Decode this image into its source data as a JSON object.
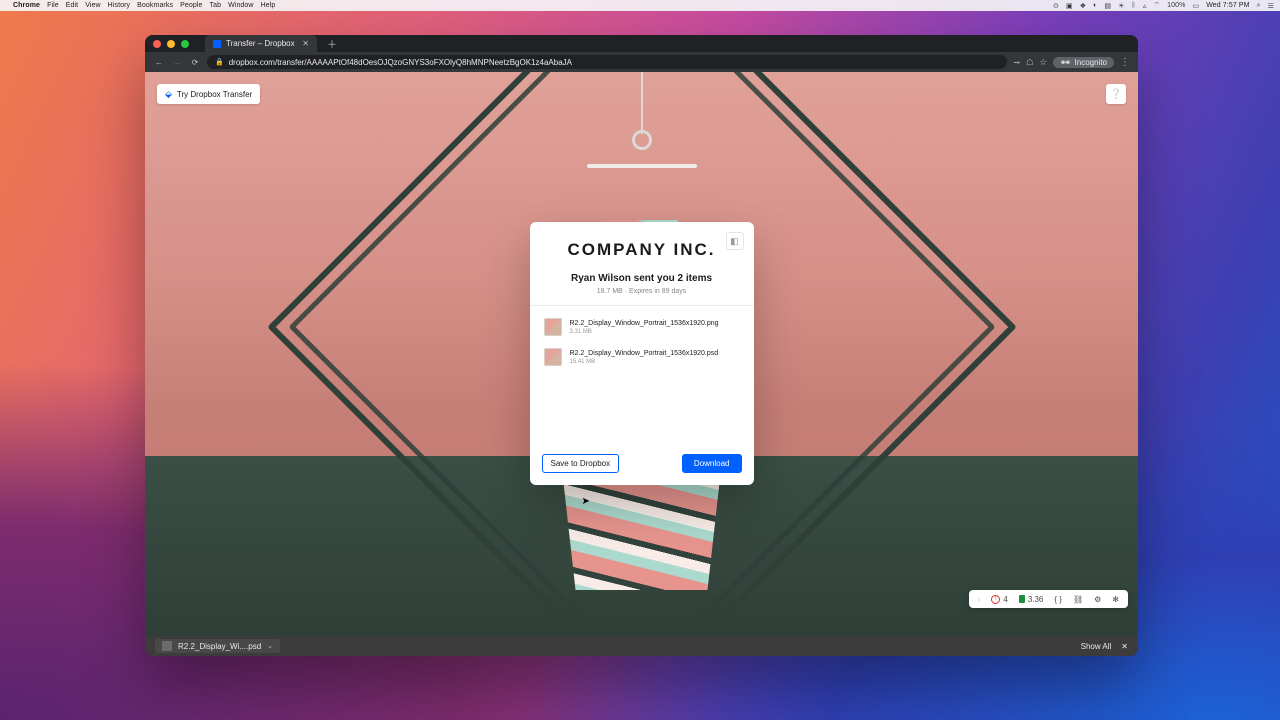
{
  "mac_menu": {
    "app": "Chrome",
    "items": [
      "File",
      "Edit",
      "View",
      "History",
      "Bookmarks",
      "People",
      "Tab",
      "Window",
      "Help"
    ],
    "battery": "100%",
    "clock": "Wed 7:57 PM"
  },
  "browser": {
    "tab_title": "Transfer – Dropbox",
    "url": "dropbox.com/transfer/AAAAAPtOf48dOesOJQzoGNYS3oFXOlyQ8hMNPNeetzBgOK1z4aAbaJA",
    "incognito_label": "Incognito"
  },
  "page": {
    "try_button": "Try Dropbox Transfer",
    "brand": "COMPANY INC.",
    "headline": "Ryan Wilson sent you 2 items",
    "subline": "18.7 MB · Expires in 89 days",
    "files": [
      {
        "name": "R2.2_Display_Window_Portrait_1536x1920.png",
        "meta": "3.31 MB"
      },
      {
        "name": "R2.2_Display_Window_Portrait_1536x1920.psd",
        "meta": "15.41 MB"
      }
    ],
    "save_label": "Save to Dropbox",
    "download_label": "Download"
  },
  "dev_toolbar": {
    "count": "4",
    "timing": "3.36"
  },
  "download_shelf": {
    "file": "R2.2_Display_Wi....psd",
    "show_all": "Show All"
  }
}
